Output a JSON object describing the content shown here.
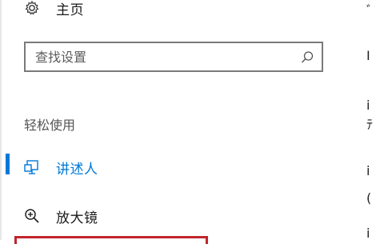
{
  "nav": {
    "home_label": "主页",
    "search_placeholder": "查找设置",
    "section_header": "轻松使用",
    "items": [
      {
        "label": "讲述人",
        "icon": "narrator-icon",
        "selected": true
      },
      {
        "label": "放大镜",
        "icon": "magnifier-icon",
        "selected": false
      }
    ]
  },
  "right_pane": {
    "fragments": [
      "ﾞ",
      "I",
      "i",
      "ﾃ",
      "i",
      "(",
      "i"
    ]
  },
  "colors": {
    "accent": "#0078d7",
    "highlight": "#c0252b",
    "text": "#1a1a1a",
    "muted": "#555555"
  }
}
